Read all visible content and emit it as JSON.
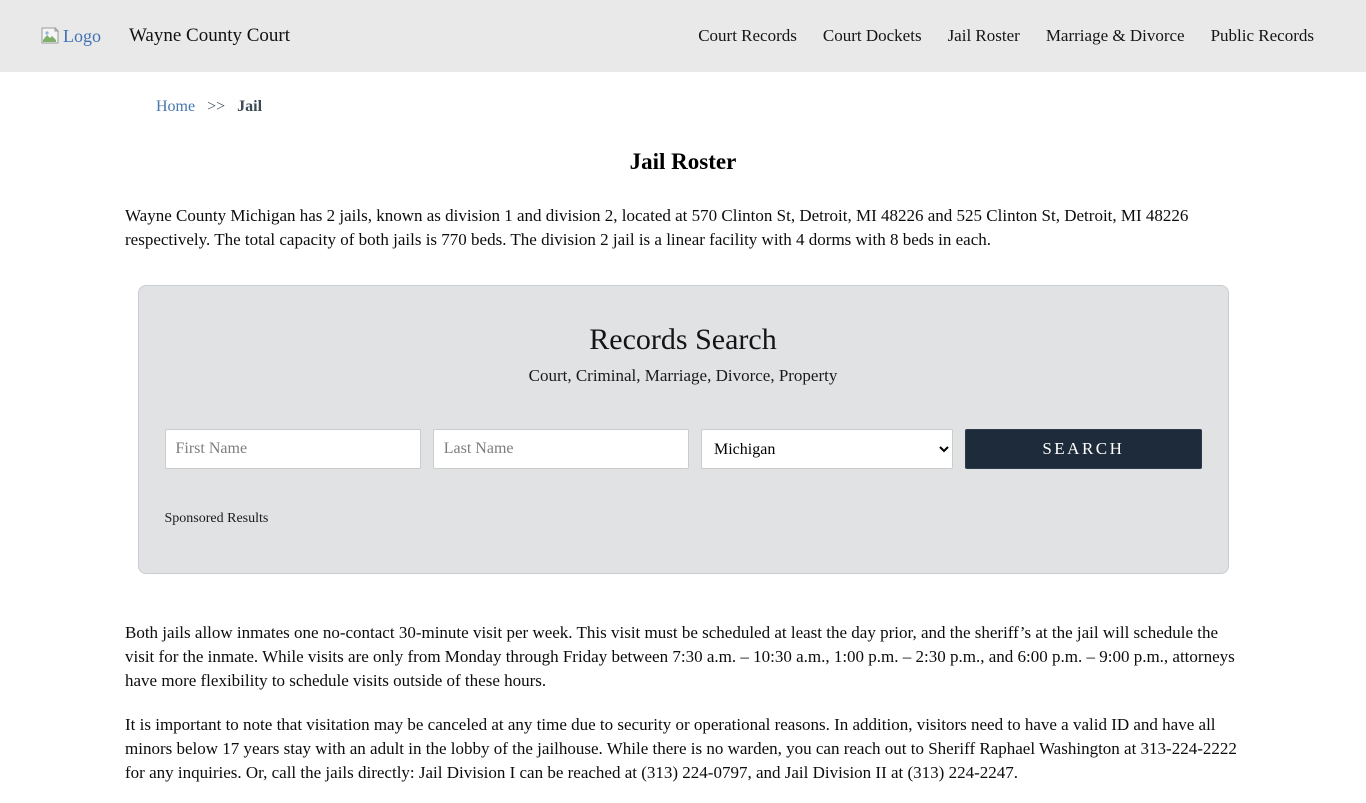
{
  "header": {
    "logo_alt": "Logo",
    "brand": "Wayne County Court",
    "nav": [
      {
        "label": "Court Records"
      },
      {
        "label": "Court Dockets"
      },
      {
        "label": "Jail Roster"
      },
      {
        "label": "Marriage & Divorce"
      },
      {
        "label": "Public Records"
      }
    ]
  },
  "breadcrumb": {
    "home": "Home",
    "separator": ">>",
    "current": "Jail"
  },
  "page": {
    "title": "Jail Roster",
    "intro": "Wayne County Michigan has 2 jails, known as division 1 and division 2, located at 570 Clinton St, Detroit, MI 48226 and 525 Clinton St, Detroit, MI 48226 respectively. The total capacity of both jails is 770 beds. The division 2 jail is a linear facility with 4 dorms with 8 beds in each.",
    "visit_info": "Both jails allow inmates one no-contact 30-minute visit per week. This visit must be scheduled at least the day prior, and the sheriff’s at the jail will schedule the visit for the inmate. While visits are only from Monday through Friday between 7:30 a.m. – 10:30 a.m., 1:00 p.m. – 2:30 p.m., and 6:00 p.m. – 9:00 p.m., attorneys have more flexibility to schedule visits outside of these hours.",
    "visitation_note": "It is important to note that visitation may be canceled at any time due to security or operational reasons. In addition, visitors need to have a valid ID and have all minors below 17 years stay with an adult in the lobby of the jailhouse. While there is no warden, you can reach out to Sheriff Raphael Washington at 313-224-2222 for any inquiries. Or, call the jails directly: Jail Division I can be reached at (313) 224-0797, and Jail Division II at (313) 224-2247."
  },
  "search": {
    "title": "Records Search",
    "subtitle": "Court, Criminal, Marriage, Divorce, Property",
    "first_name_placeholder": "First Name",
    "last_name_placeholder": "Last Name",
    "state_selected": "Michigan",
    "search_button": "SEARCH",
    "sponsored_label": "Sponsored Results"
  },
  "colors": {
    "header_bg": "#e9e9e9",
    "panel_bg": "#e0e2e4",
    "button_bg": "#1d2b3b",
    "link_blue": "#4677ae",
    "breadcrumb_current": "#3c4a56"
  }
}
